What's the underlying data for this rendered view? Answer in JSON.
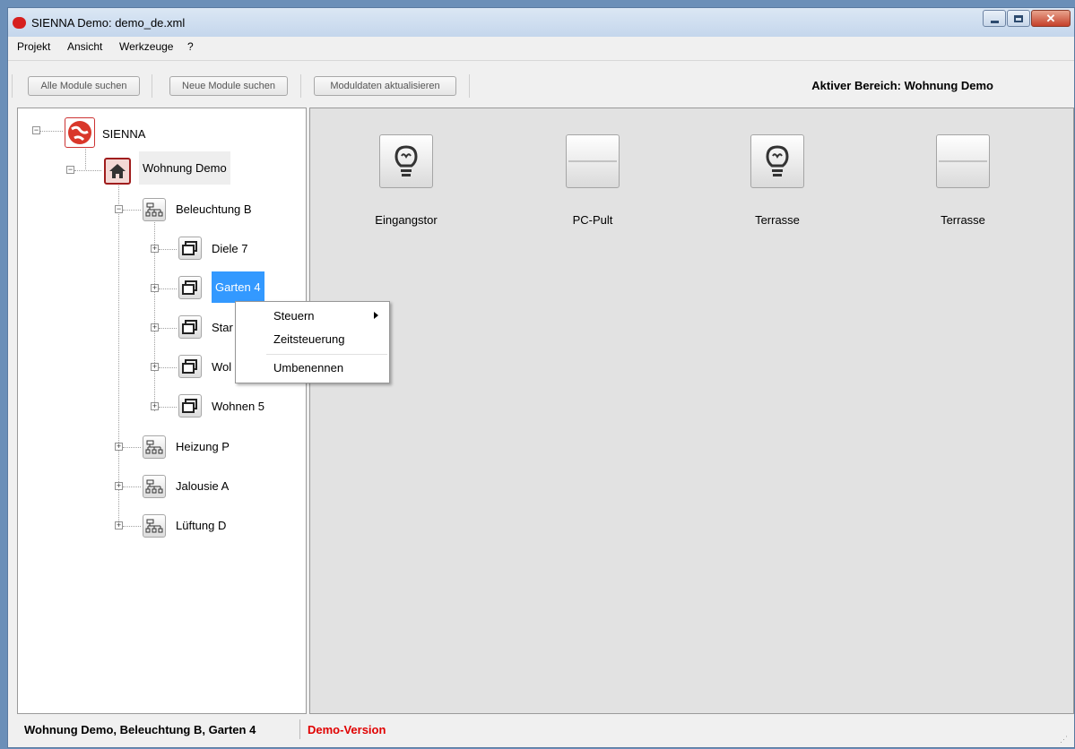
{
  "window": {
    "title": "SIENNA Demo:  demo_de.xml",
    "close_glyph": "✕"
  },
  "menu": [
    {
      "label": "Projekt"
    },
    {
      "label": "Ansicht"
    },
    {
      "label": "Werkzeuge"
    },
    {
      "label": "?"
    }
  ],
  "toolbar": {
    "find_all": "Alle Module suchen",
    "find_new": "Neue Module suchen",
    "update": "Moduldaten aktualisieren",
    "active_area": "Aktiver Bereich: Wohnung Demo"
  },
  "tree": {
    "root": "SIENNA",
    "home": "Wohnung Demo",
    "groups": [
      {
        "label": "Beleuchtung B",
        "expanded": true
      },
      {
        "label": "Heizung P",
        "expanded": false
      },
      {
        "label": "Jalousie A",
        "expanded": false
      },
      {
        "label": "Lüftung D",
        "expanded": false
      }
    ],
    "rooms": [
      {
        "label": "Diele 7"
      },
      {
        "label": "Garten 4",
        "selected": true
      },
      {
        "label": "Star"
      },
      {
        "label": "Wol"
      },
      {
        "label": "Wohnen 5"
      }
    ]
  },
  "modules": [
    {
      "label": "Eingangstor",
      "icon": "light-bulb-icon"
    },
    {
      "label": "PC-Pult",
      "icon": "switch-icon"
    },
    {
      "label": "Terrasse",
      "icon": "light-bulb-icon"
    },
    {
      "label": "Terrasse",
      "icon": "switch-icon"
    }
  ],
  "context_menu": {
    "steuern": "Steuern",
    "zeitsteuerung": "Zeitsteuerung",
    "umbenennen": "Umbenennen"
  },
  "status": {
    "path": "Wohnung Demo, Beleuchtung B, Garten 4",
    "demo": "Demo-Version"
  },
  "colors": {
    "selection": "#3399ff",
    "demo_text": "#e00000",
    "main_bg": "#e2e2e2"
  }
}
